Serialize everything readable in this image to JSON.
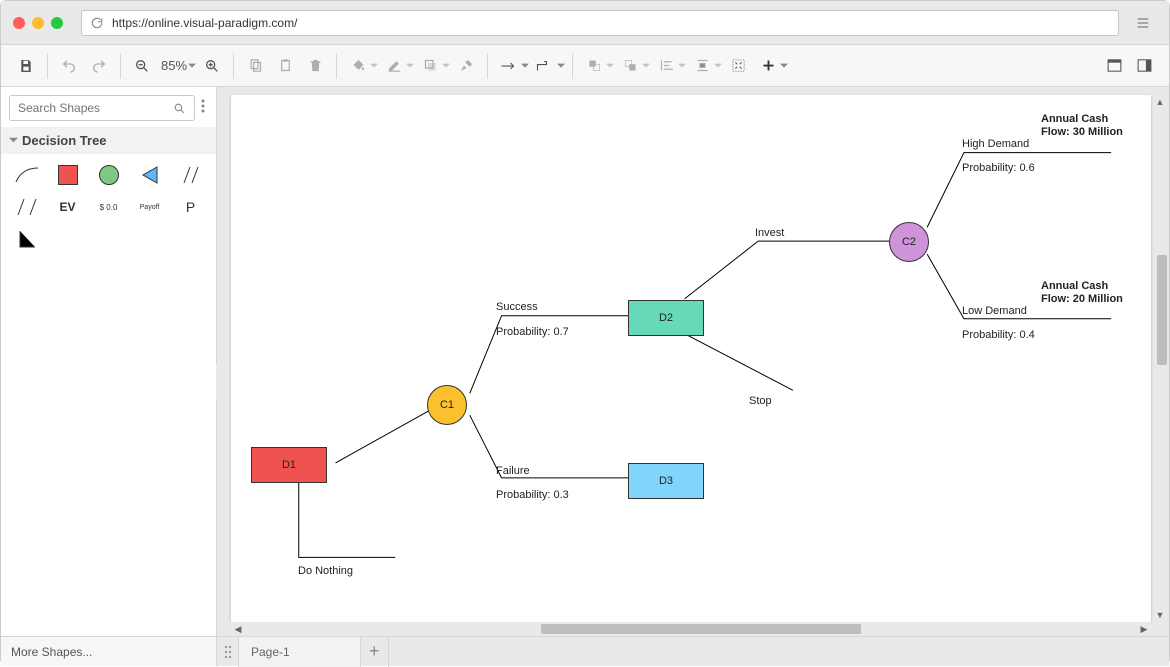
{
  "browser": {
    "url": "https://online.visual-paradigm.com/"
  },
  "toolbar": {
    "zoom": "85%"
  },
  "sidebar": {
    "search_placeholder": "Search Shapes",
    "panel_title": "Decision Tree",
    "palette": {
      "ev": "EV",
      "cost": "$ 0.0",
      "payoff": "Payoff",
      "p": "P"
    },
    "more_shapes": "More Shapes..."
  },
  "pages": {
    "current": "Page-1"
  },
  "diagram": {
    "nodes": {
      "d1": "D1",
      "c1": "C1",
      "d2": "D2",
      "d3": "D3",
      "c2": "C2"
    },
    "labels": {
      "do_nothing": "Do Nothing",
      "success": "Success",
      "prob07": "Probability: 0.7",
      "failure": "Failure",
      "prob03": "Probability: 0.3",
      "invest": "Invest",
      "stop": "Stop",
      "high_demand": "High Demand",
      "prob06": "Probability: 0.6",
      "low_demand": "Low Demand",
      "prob04": "Probability: 0.4",
      "cash30a": "Annual Cash",
      "cash30b": "Flow: 30 Million",
      "cash20a": "Annual Cash",
      "cash20b": "Flow: 20 Million"
    }
  }
}
